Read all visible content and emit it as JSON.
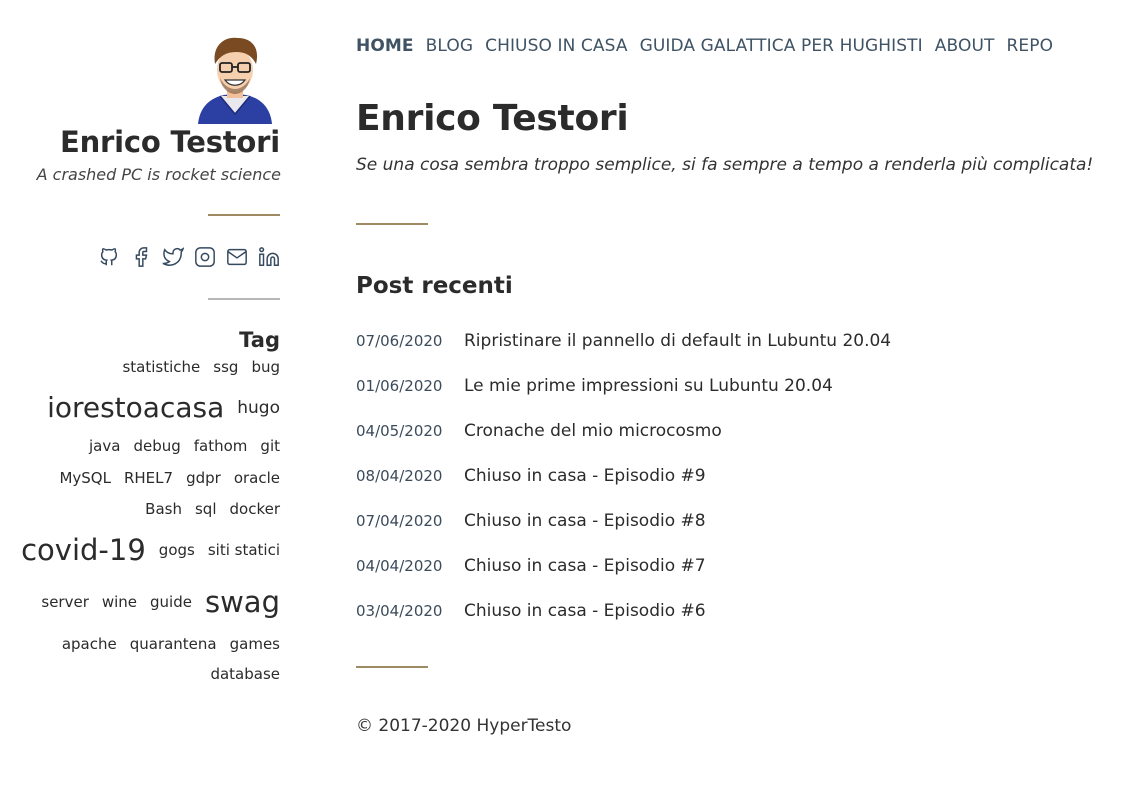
{
  "sidebar": {
    "title": "Enrico Testori",
    "tagline": "A crashed PC is rocket science",
    "avatar_icon": "avatar-icon",
    "social": [
      {
        "name": "github-icon"
      },
      {
        "name": "facebook-icon"
      },
      {
        "name": "twitter-icon"
      },
      {
        "name": "instagram-icon"
      },
      {
        "name": "mail-icon"
      },
      {
        "name": "linkedin-icon"
      }
    ],
    "tags_title": "Tag",
    "tags": {
      "statistiche": "statistiche",
      "ssg": "ssg",
      "bug": "bug",
      "iorestoacasa": "iorestoacasa",
      "hugo": "hugo",
      "java": "java",
      "debug": "debug",
      "fathom": "fathom",
      "git": "git",
      "mysql": "MySQL",
      "rhel7": "RHEL7",
      "gdpr": "gdpr",
      "oracle": "oracle",
      "bash": "Bash",
      "sql": "sql",
      "docker": "docker",
      "covid19": "covid-19",
      "gogs": "gogs",
      "siti_statici": "siti statici",
      "server": "server",
      "wine": "wine",
      "guide": "guide",
      "swag": "swag",
      "apache": "apache",
      "quarantena": "quarantena",
      "games": "games",
      "database": "database"
    }
  },
  "nav": {
    "home": "HOME",
    "blog": "BLOG",
    "chiuso": "CHIUSO IN CASA",
    "guida": "GUIDA GALATTICA PER HUGHISTI",
    "about": "ABOUT",
    "repo": "REPO"
  },
  "main": {
    "title": "Enrico Testori",
    "tagline": "Se una cosa sembra troppo semplice, si fa sempre a tempo a renderla più complicata!",
    "recent_title": "Post recenti",
    "posts": [
      {
        "date": "07/06/2020",
        "title": "Ripristinare il pannello di default in Lubuntu 20.04"
      },
      {
        "date": "01/06/2020",
        "title": "Le mie prime impressioni su Lubuntu 20.04"
      },
      {
        "date": "04/05/2020",
        "title": "Cronache del mio microcosmo"
      },
      {
        "date": "08/04/2020",
        "title": "Chiuso in casa - Episodio #9"
      },
      {
        "date": "07/04/2020",
        "title": "Chiuso in casa - Episodio #8"
      },
      {
        "date": "04/04/2020",
        "title": "Chiuso in casa - Episodio #7"
      },
      {
        "date": "03/04/2020",
        "title": "Chiuso in casa - Episodio #6"
      }
    ],
    "footer": "© 2017-2020 HyperTesto"
  },
  "colors": {
    "accent_rule": "#9e8a63",
    "nav_text": "#3f5365",
    "body_text": "#2b2b2b"
  }
}
